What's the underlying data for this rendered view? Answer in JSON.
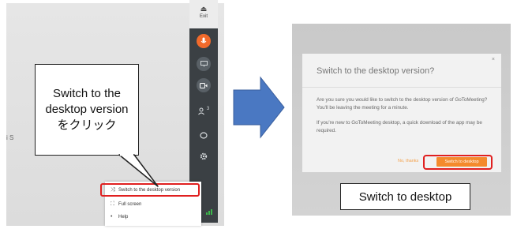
{
  "left_screenshot": {
    "exit_label": "Exit",
    "exit_glyph": "⏏",
    "edge_text": "i S",
    "sidebar_icons": [
      "microphone-icon",
      "screen-share-icon",
      "camera-icon",
      "people-icon",
      "chat-icon",
      "gear-icon",
      "signal-icon"
    ],
    "people_count": "3",
    "menu": {
      "items": [
        {
          "icon": "⤨",
          "label": "Switch to the desktop version"
        },
        {
          "icon": "⛶",
          "label": "Full screen"
        },
        {
          "icon": "•",
          "label": "Help"
        }
      ]
    },
    "callout": {
      "line1": "Switch to the",
      "line2": "desktop version",
      "line3": "をクリック"
    }
  },
  "right_screenshot": {
    "dialog": {
      "close": "×",
      "title": "Switch to the desktop version?",
      "body1": "Are you sure you would like to switch to the desktop version of GoToMeeting? You'll be leaving the meeting for a minute.",
      "body2": "If you're new to GoToMeeting desktop, a quick download of the app may be required.",
      "no_thanks": "No, thanks",
      "switch_button": "Switch to desktop"
    },
    "label_box": "Switch to desktop"
  },
  "colors": {
    "accent_orange": "#f26a2b",
    "highlight_red": "#e02020",
    "arrow_blue": "#4a78c2",
    "sidebar_dark": "#3b4044"
  }
}
